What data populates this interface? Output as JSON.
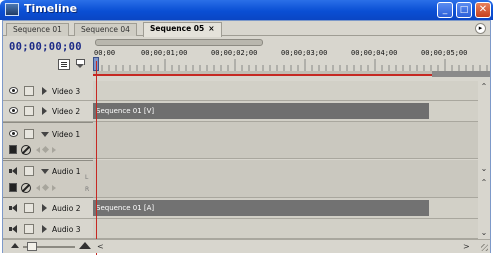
{
  "window": {
    "title": "Timeline",
    "minimize_glyph": "_",
    "maximize_glyph": "□",
    "close_glyph": "✕"
  },
  "tabs": [
    {
      "label": "Sequence 01",
      "active": false
    },
    {
      "label": "Sequence 04",
      "active": false
    },
    {
      "label": "Sequence 05",
      "active": true,
      "close": "×"
    }
  ],
  "panel_menu_glyph": "▸",
  "timecode": "00;00;00;00",
  "ruler": {
    "times": [
      "00;00",
      "00;00;01;00",
      "00;00;02;00",
      "00;00;03;00",
      "00;00;04;00",
      "00;00;05;00"
    ]
  },
  "tracks": {
    "video3": {
      "name": "Video 3"
    },
    "video2": {
      "name": "Video 2",
      "clip": "Sequence 01 [V]"
    },
    "video1": {
      "name": "Video 1"
    },
    "audio1": {
      "name": "Audio 1",
      "left_right": [
        "L",
        "R"
      ]
    },
    "audio2": {
      "name": "Audio 2",
      "clip": "Sequence 01 [A]"
    },
    "audio3": {
      "name": "Audio 3"
    }
  },
  "scroll": {
    "up": "⌃",
    "down": "⌄",
    "left": "<",
    "right": ">"
  },
  "colors": {
    "titlebar": "#0a4fd4",
    "timecode": "#1c2a86",
    "playhead": "#c62822",
    "clip": "#6f6f6f",
    "panel": "#d8d6ce"
  }
}
